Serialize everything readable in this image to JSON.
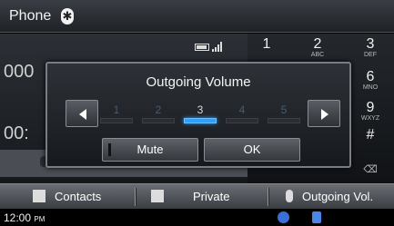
{
  "title_bar": {
    "title": "Phone",
    "bt_icon": "bluetooth-icon"
  },
  "call": {
    "number_partial": "000",
    "time_partial": "00:"
  },
  "keypad": [
    {
      "digit": "1",
      "letters": ""
    },
    {
      "digit": "2",
      "letters": "ABC"
    },
    {
      "digit": "3",
      "letters": "DEF"
    },
    {
      "digit": "6",
      "letters": "MNO"
    },
    {
      "digit": "9",
      "letters": "WXYZ"
    },
    {
      "digit": "#",
      "letters": ""
    }
  ],
  "dialog": {
    "title": "Outgoing Volume",
    "levels": [
      "1",
      "2",
      "3",
      "4",
      "5"
    ],
    "selected_level": 3,
    "mute_label": "Mute",
    "ok_label": "OK"
  },
  "bottom_bar": {
    "contacts_label": "Contacts",
    "private_label": "Private",
    "outgoing_label": "Outgoing Vol."
  },
  "status": {
    "time": "12:00",
    "ampm": "PM"
  }
}
